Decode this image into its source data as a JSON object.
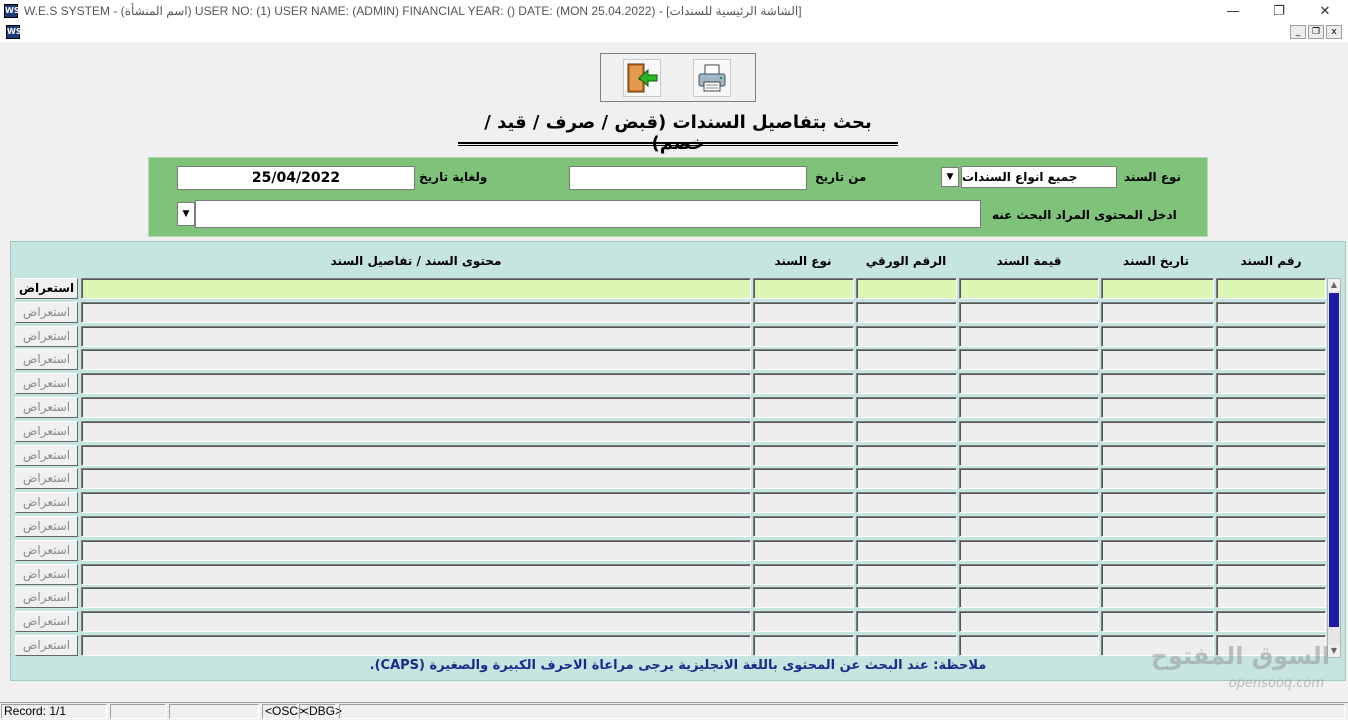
{
  "window": {
    "title": "W.E.S SYSTEM -  (اسم المنشأة)  USER NO: (1) USER NAME: (ADMIN) FINANCIAL YEAR: ()  DATE: (MON 25.04.2022) - [الشاشة الرئيسية للسندات]",
    "controls": {
      "minimize": "—",
      "restore": "❐",
      "close": "✕"
    },
    "mdi_controls": {
      "minimize": "_",
      "restore": "❐",
      "close": "x"
    }
  },
  "toolbar": {
    "exit_icon": "exit-door-icon",
    "print_icon": "printer-icon"
  },
  "page": {
    "title": "بحث بتفاصيل السندات (قبض / صرف / قيد / خصم)"
  },
  "search": {
    "voucher_type_label": "نوع السند",
    "voucher_type_value": "جميع انواع السندات",
    "from_date_label": "من تاريخ",
    "from_date_value": "",
    "to_date_label": "ولغاية تاريخ",
    "to_date_value": "25/04/2022",
    "content_label": "ادخل المحتوى المراد البحث عنه",
    "content_value": ""
  },
  "grid": {
    "columns": [
      "رقم السند",
      "تاريخ السند",
      "قيمة السند",
      "الرقم الورقي",
      "نوع السند",
      "محتوى السند / تفاصيل السند"
    ],
    "row_button_label": "استعراض",
    "row_count": 16,
    "active_row": 0
  },
  "note": "ملاحظة: عند البحث عن المحتوى باللغة الانجليزية يرجى مراعاة الاحرف الكبيرة والصغيرة (CAPS).",
  "status": {
    "record": "Record: 1/1",
    "osc": "<OSC>",
    "dbg": "<DBG>"
  },
  "watermark": {
    "arabic": "السوق المفتوح",
    "latin": "opensooq.com"
  },
  "colors": {
    "panel_green": "#7fc27a",
    "grid_bg": "#c6e4e0",
    "active_row": "#dcf7b4",
    "scroll_thumb": "#1c1ca8"
  }
}
